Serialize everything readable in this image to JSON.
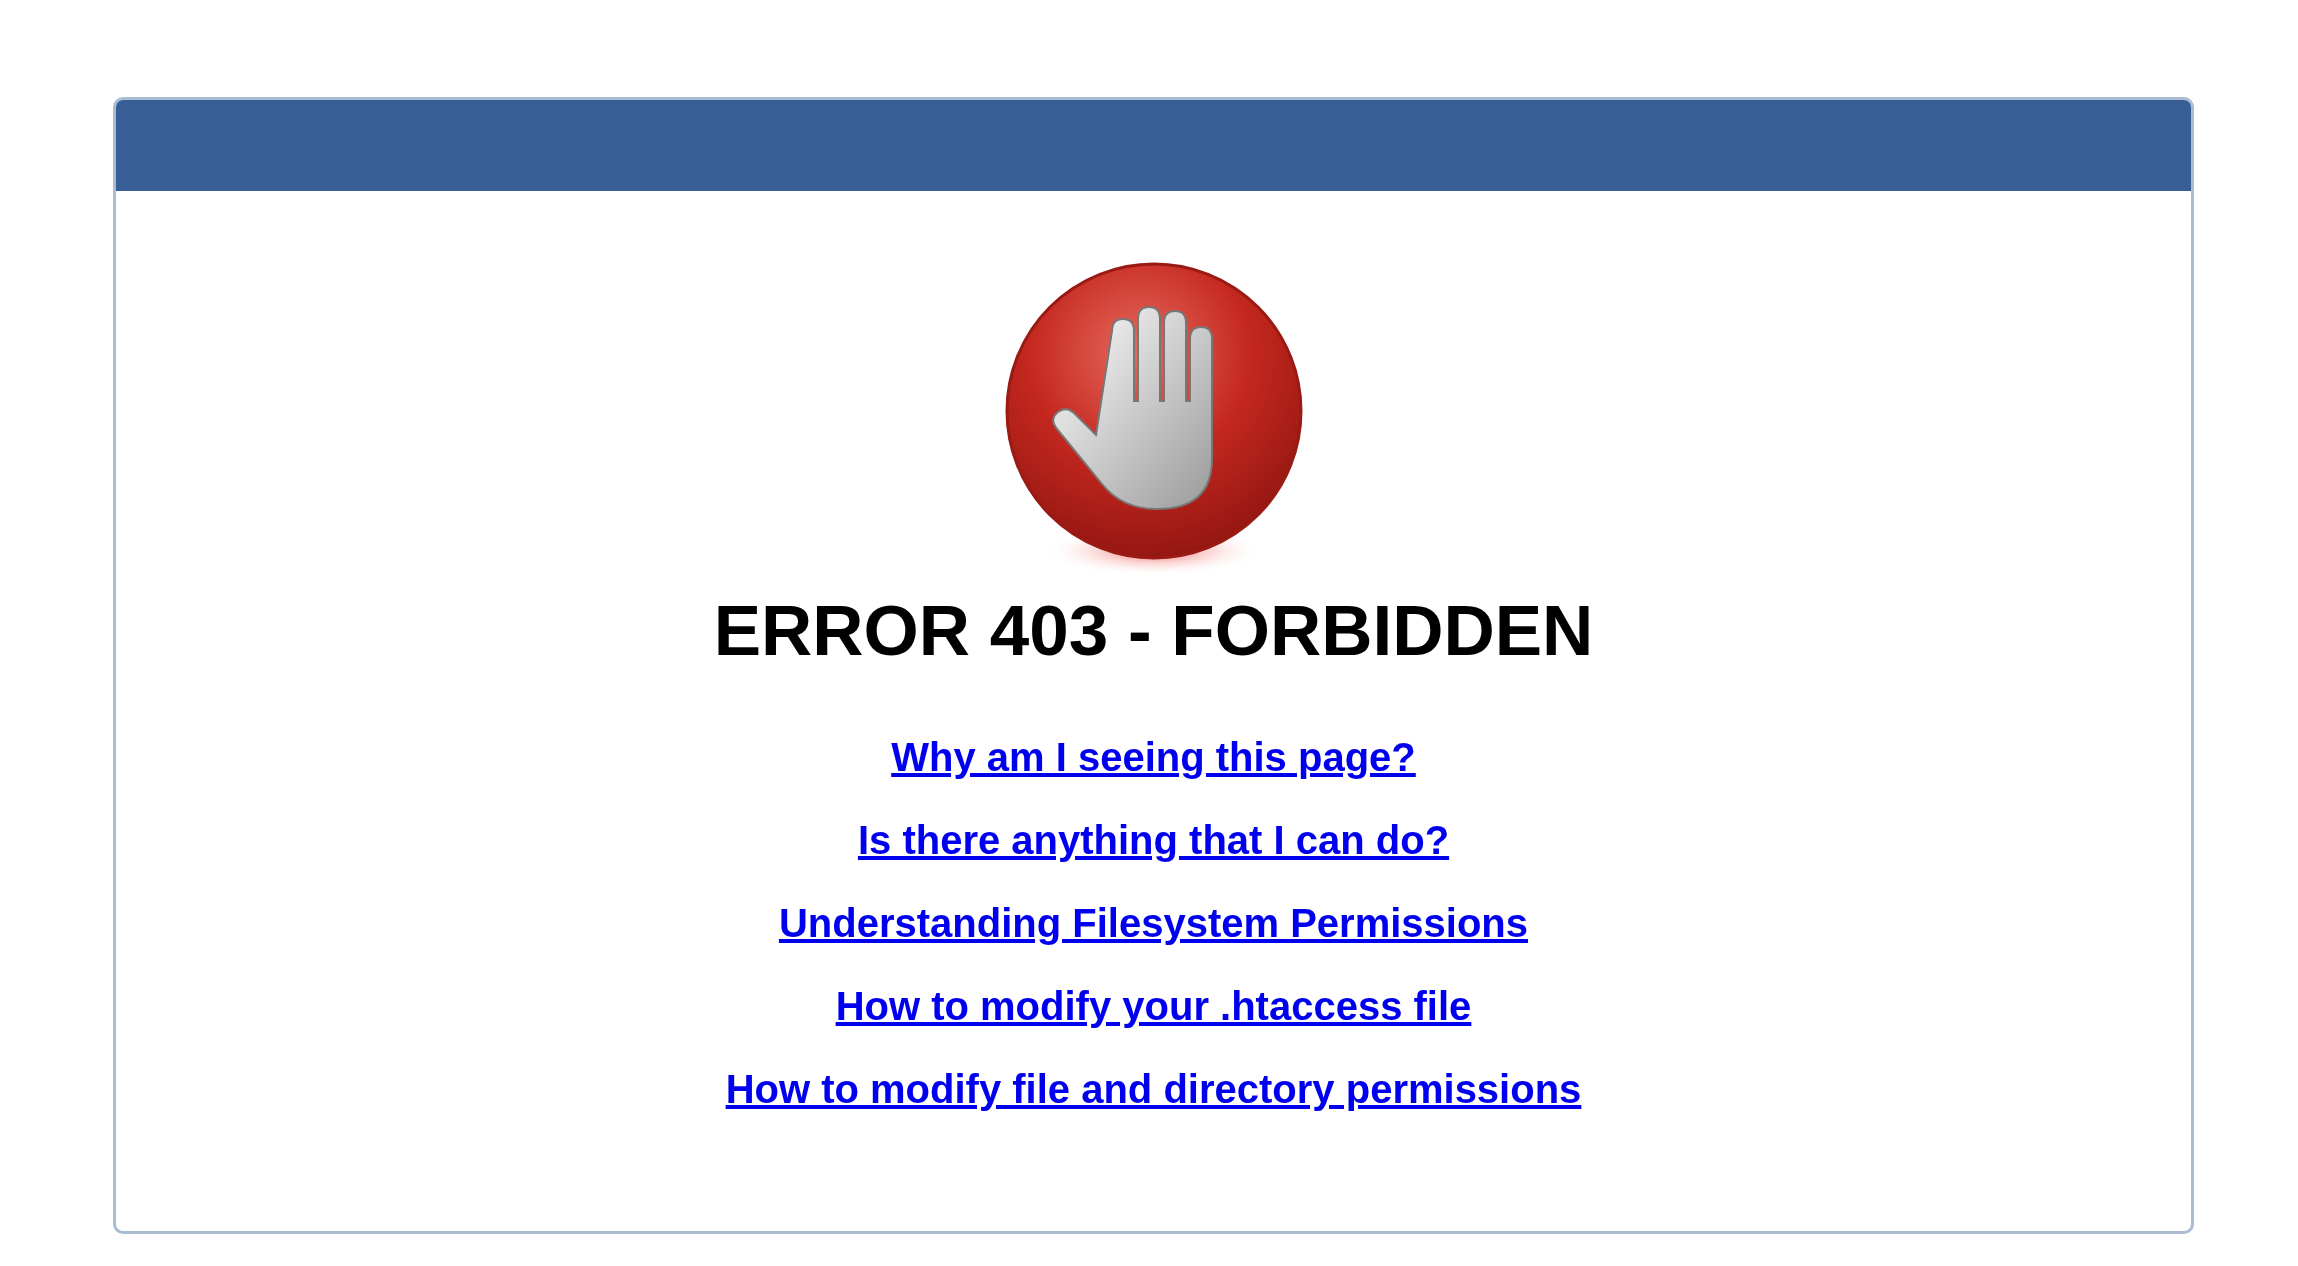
{
  "heading": "ERROR 403 - FORBIDDEN",
  "links": [
    "Why am I seeing this page?",
    "Is there anything that I can do?",
    "Understanding Filesystem Permissions",
    "How to modify your .htaccess file",
    "How to modify file and directory permissions"
  ]
}
